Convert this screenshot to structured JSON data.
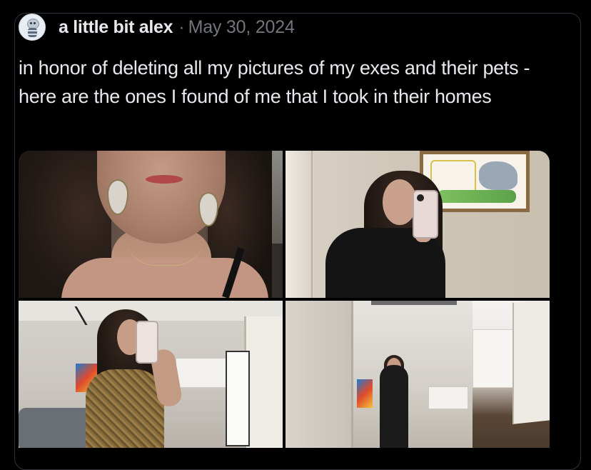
{
  "post": {
    "author_name": "a little bit alex",
    "separator": "·",
    "date": "May 30, 2024",
    "text": "in honor of deleting all my pictures of my exes and their pets - here are the ones I found of me  that I took in their homes",
    "avatar_icon": "cartoon-avatar-icon",
    "photos": [
      {
        "label": "photo-1-closeup-selfie"
      },
      {
        "label": "photo-2-mirror-selfie-with-framed-drawing"
      },
      {
        "label": "photo-3-living-room-mirror-selfie"
      },
      {
        "label": "photo-4-full-length-mirror-selfie"
      }
    ]
  },
  "colors": {
    "background": "#000000",
    "primary_text": "#e7e9ea",
    "secondary_text": "#71767b",
    "card_border": "#2f3336"
  }
}
